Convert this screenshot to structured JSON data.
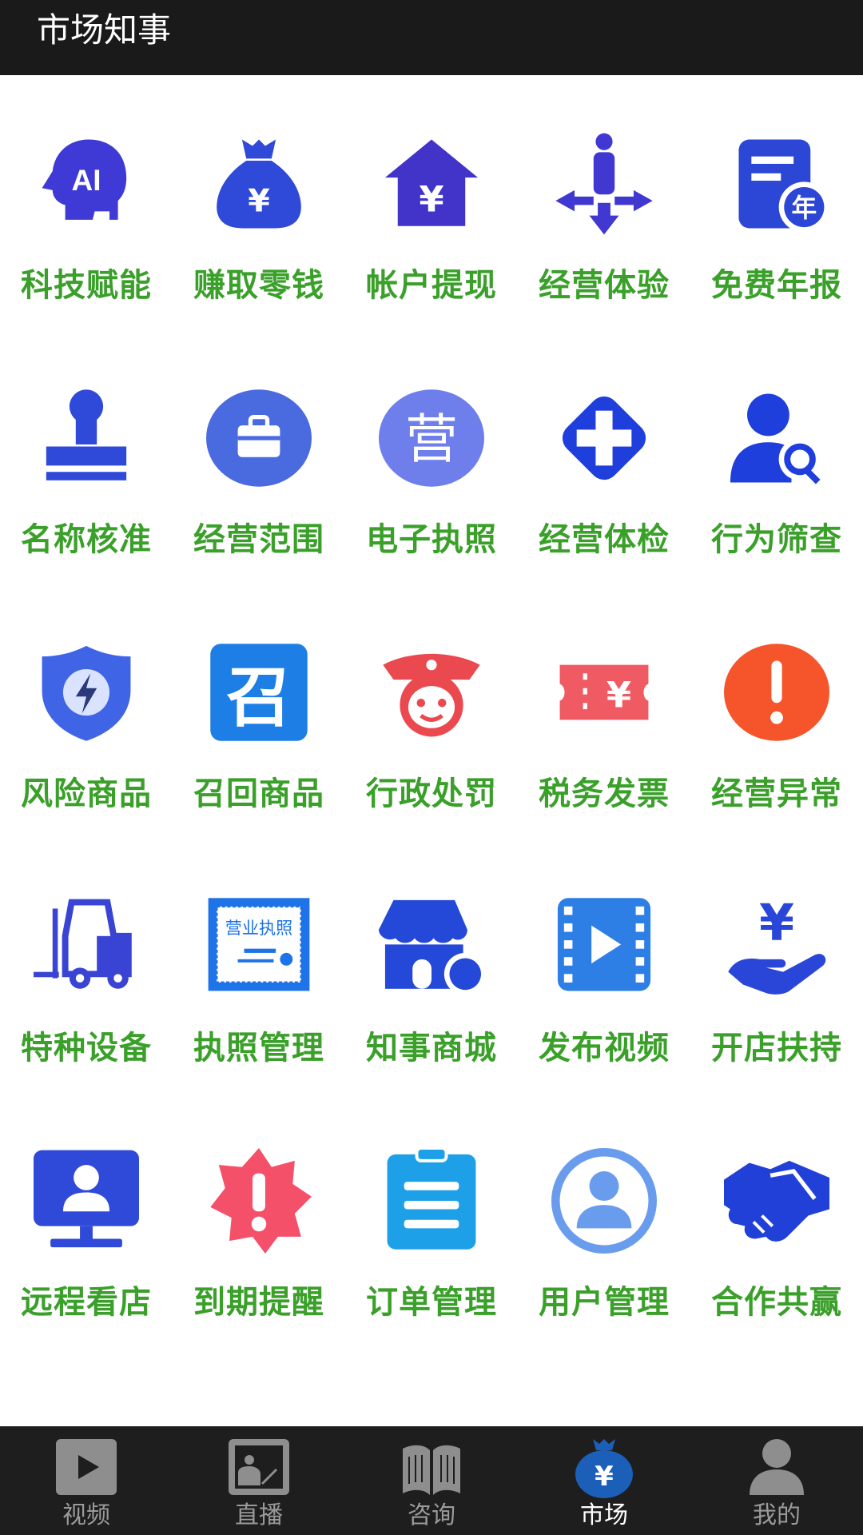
{
  "header": {
    "title": "市场知事"
  },
  "grid": [
    {
      "label": "科技赋能",
      "icon": "ai-head-icon",
      "badge": "AI"
    },
    {
      "label": "赚取零钱",
      "icon": "money-bag-icon"
    },
    {
      "label": "帐户提现",
      "icon": "house-yen-icon"
    },
    {
      "label": "经营体验",
      "icon": "person-arrows-icon"
    },
    {
      "label": "免费年报",
      "icon": "annual-report-icon",
      "badge": "年"
    },
    {
      "label": "名称核准",
      "icon": "stamp-icon"
    },
    {
      "label": "经营范围",
      "icon": "briefcase-icon"
    },
    {
      "label": "电子执照",
      "icon": "license-circle-icon",
      "badge": "营"
    },
    {
      "label": "经营体检",
      "icon": "medical-cross-icon"
    },
    {
      "label": "行为筛查",
      "icon": "person-search-icon"
    },
    {
      "label": "风险商品",
      "icon": "shield-lightning-icon"
    },
    {
      "label": "召回商品",
      "icon": "recall-icon",
      "badge": "召"
    },
    {
      "label": "行政处罚",
      "icon": "police-icon"
    },
    {
      "label": "税务发票",
      "icon": "ticket-yen-icon"
    },
    {
      "label": "经营异常",
      "icon": "warning-circle-icon"
    },
    {
      "label": "特种设备",
      "icon": "forklift-icon"
    },
    {
      "label": "执照管理",
      "icon": "business-license-icon",
      "badge": "营业执照"
    },
    {
      "label": "知事商城",
      "icon": "shop-icon"
    },
    {
      "label": "发布视频",
      "icon": "video-film-icon"
    },
    {
      "label": "开店扶持",
      "icon": "hand-yen-icon"
    },
    {
      "label": "远程看店",
      "icon": "monitor-person-icon"
    },
    {
      "label": "到期提醒",
      "icon": "alert-badge-icon"
    },
    {
      "label": "订单管理",
      "icon": "clipboard-icon"
    },
    {
      "label": "用户管理",
      "icon": "user-circle-icon"
    },
    {
      "label": "合作共赢",
      "icon": "handshake-icon"
    }
  ],
  "tabs": [
    {
      "label": "视频",
      "icon": "video-play-icon",
      "active": false
    },
    {
      "label": "直播",
      "icon": "live-image-icon",
      "active": false
    },
    {
      "label": "咨询",
      "icon": "book-icon",
      "active": false
    },
    {
      "label": "市场",
      "icon": "money-bag-icon",
      "active": true
    },
    {
      "label": "我的",
      "icon": "user-icon",
      "active": false
    }
  ],
  "colors": {
    "header_bg": "#1a1a1a",
    "label_green": "#3aa02a",
    "icon_blue": "#2f49d8",
    "tabbar_bg": "#1e1e1e",
    "tab_active": "#ffffff",
    "tab_inactive": "#9a9a9a"
  }
}
